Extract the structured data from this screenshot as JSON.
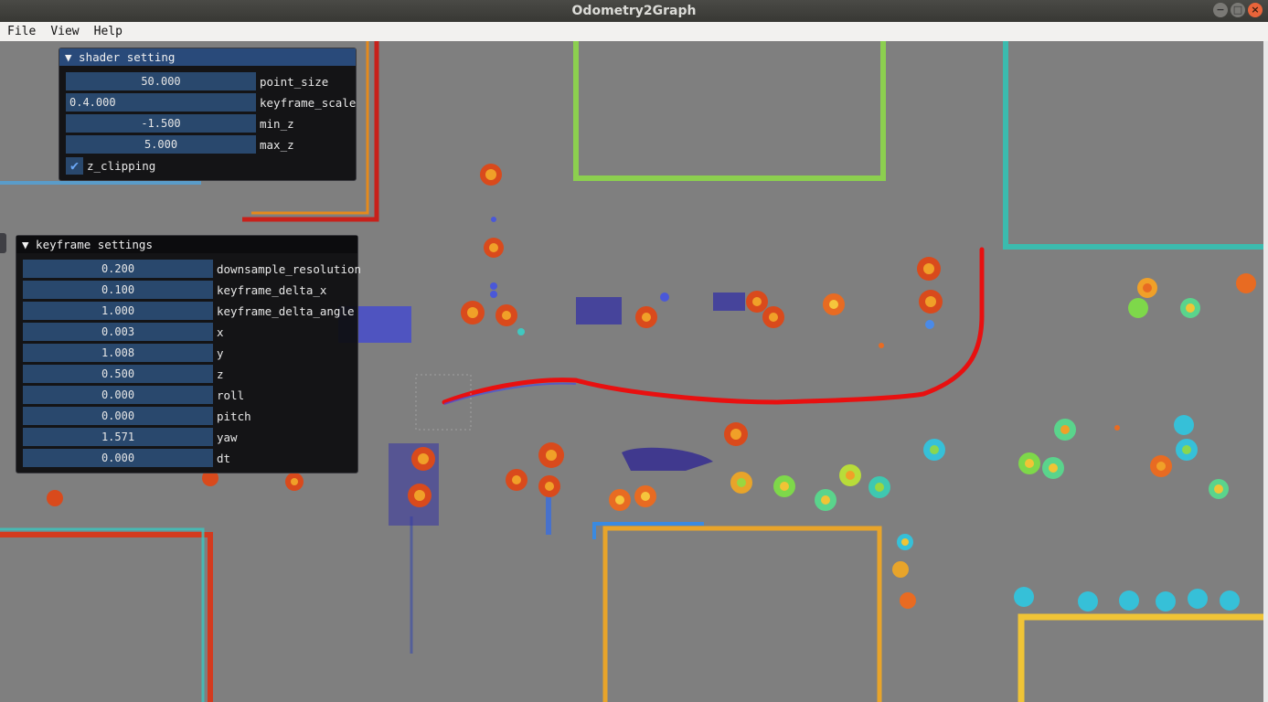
{
  "window": {
    "title": "Odometry2Graph",
    "minimize_label": "−",
    "maximize_label": "□",
    "close_label": "×"
  },
  "menu": {
    "items": [
      {
        "label": "File"
      },
      {
        "label": "View"
      },
      {
        "label": "Help"
      }
    ]
  },
  "shader_panel": {
    "title": "▼ shader setting",
    "rows": [
      {
        "value": "50.000",
        "label": "point_size"
      },
      {
        "value": "0.4.000",
        "label": "keyframe_scale"
      },
      {
        "value": "-1.500",
        "label": "min_z"
      },
      {
        "value": "5.000",
        "label": "max_z"
      }
    ],
    "checkbox": {
      "label": "z_clipping",
      "checked": true,
      "mark": "✔"
    }
  },
  "keyframe_panel": {
    "title": "▼ keyframe settings",
    "rows": [
      {
        "value": "0.200",
        "label": "downsample_resolution"
      },
      {
        "value": "0.100",
        "label": "keyframe_delta_x"
      },
      {
        "value": "1.000",
        "label": "keyframe_delta_angle"
      },
      {
        "value": "0.003",
        "label": "x"
      },
      {
        "value": "1.008",
        "label": "y"
      },
      {
        "value": "0.500",
        "label": "z"
      },
      {
        "value": "0.000",
        "label": "roll"
      },
      {
        "value": "0.000",
        "label": "pitch"
      },
      {
        "value": "1.571",
        "label": "yaw"
      },
      {
        "value": "0.000",
        "label": "dt"
      }
    ]
  },
  "colors": {
    "trajectory": "#e81010",
    "background": "#7f7f7f",
    "panel_field": "#29486d",
    "panel_title": "#294a7a"
  }
}
